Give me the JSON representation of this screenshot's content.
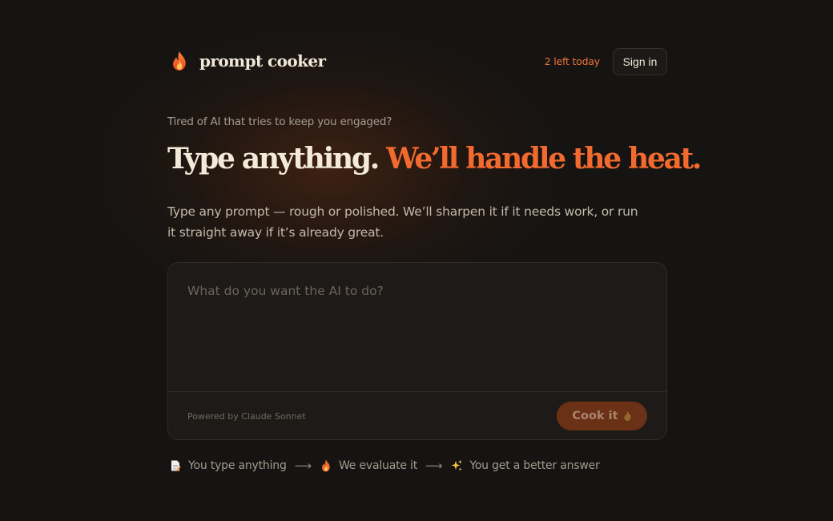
{
  "brand": {
    "name": "prompt cooker",
    "icon": "flame-icon"
  },
  "header": {
    "usage": "2 left today",
    "signin_label": "Sign in"
  },
  "hero": {
    "eyebrow": "Tired of AI that tries to keep you engaged?",
    "headline_part1": "Type anything.",
    "headline_part2": "We’ll handle the heat.",
    "subtitle": "Type any prompt — rough or polished. We’ll sharpen it if it needs work, or run it straight away if it’s already great."
  },
  "composer": {
    "placeholder": "What do you want the AI to do?",
    "value": "",
    "powered_by": "Powered by Claude Sonnet",
    "submit_label": "Cook it",
    "submit_icon": "flame-icon"
  },
  "steps": [
    {
      "icon": "memo-icon",
      "label": "You type anything"
    },
    {
      "icon": "flame-icon",
      "label": "We evaluate it"
    },
    {
      "icon": "sparkles-icon",
      "label": "You get a better answer"
    }
  ],
  "steps_arrow": "⟶",
  "colors": {
    "background": "#161412",
    "accent": "#f26a2e",
    "button_bg": "#6a3117",
    "text": "#f3ead9"
  }
}
